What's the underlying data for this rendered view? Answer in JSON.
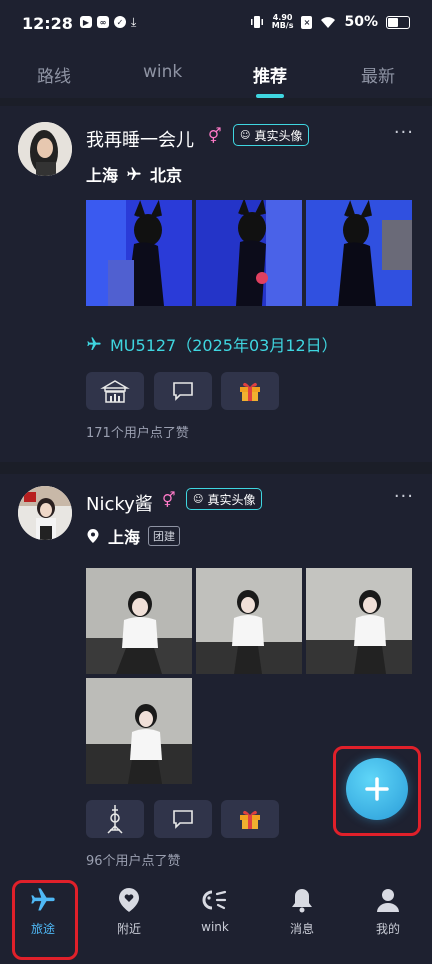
{
  "status": {
    "time": "12:28",
    "speed_top": "4.90",
    "speed_bottom": "MB/s",
    "battery": "50%"
  },
  "tabs": [
    {
      "label": "路线"
    },
    {
      "label": "wink"
    },
    {
      "label": "推荐"
    },
    {
      "label": "最新"
    }
  ],
  "posts": [
    {
      "username": "我再睡一会儿",
      "gender_symbol": "⚥",
      "verified_label": "真实头像",
      "route_from": "上海",
      "route_to": "北京",
      "flight": "MU5127（2025年03月12日）",
      "likes": "171个用户点了赞"
    },
    {
      "username": "Nicky酱",
      "gender_symbol": "⚥",
      "verified_label": "真实头像",
      "location": "上海",
      "tag": "团建",
      "likes": "96个用户点了赞"
    }
  ],
  "nav": [
    {
      "label": "旅途",
      "icon": "plane-icon"
    },
    {
      "label": "附近",
      "icon": "location-heart-icon"
    },
    {
      "label": "wink",
      "icon": "wink-icon"
    },
    {
      "label": "消息",
      "icon": "bell-icon"
    },
    {
      "label": "我的",
      "icon": "user-icon"
    }
  ],
  "colors": {
    "accent": "#3fd6e0",
    "nav_active": "#4fb8f5",
    "background": "#1b1e28",
    "card": "#1e2130",
    "highlight": "#e0202a"
  }
}
